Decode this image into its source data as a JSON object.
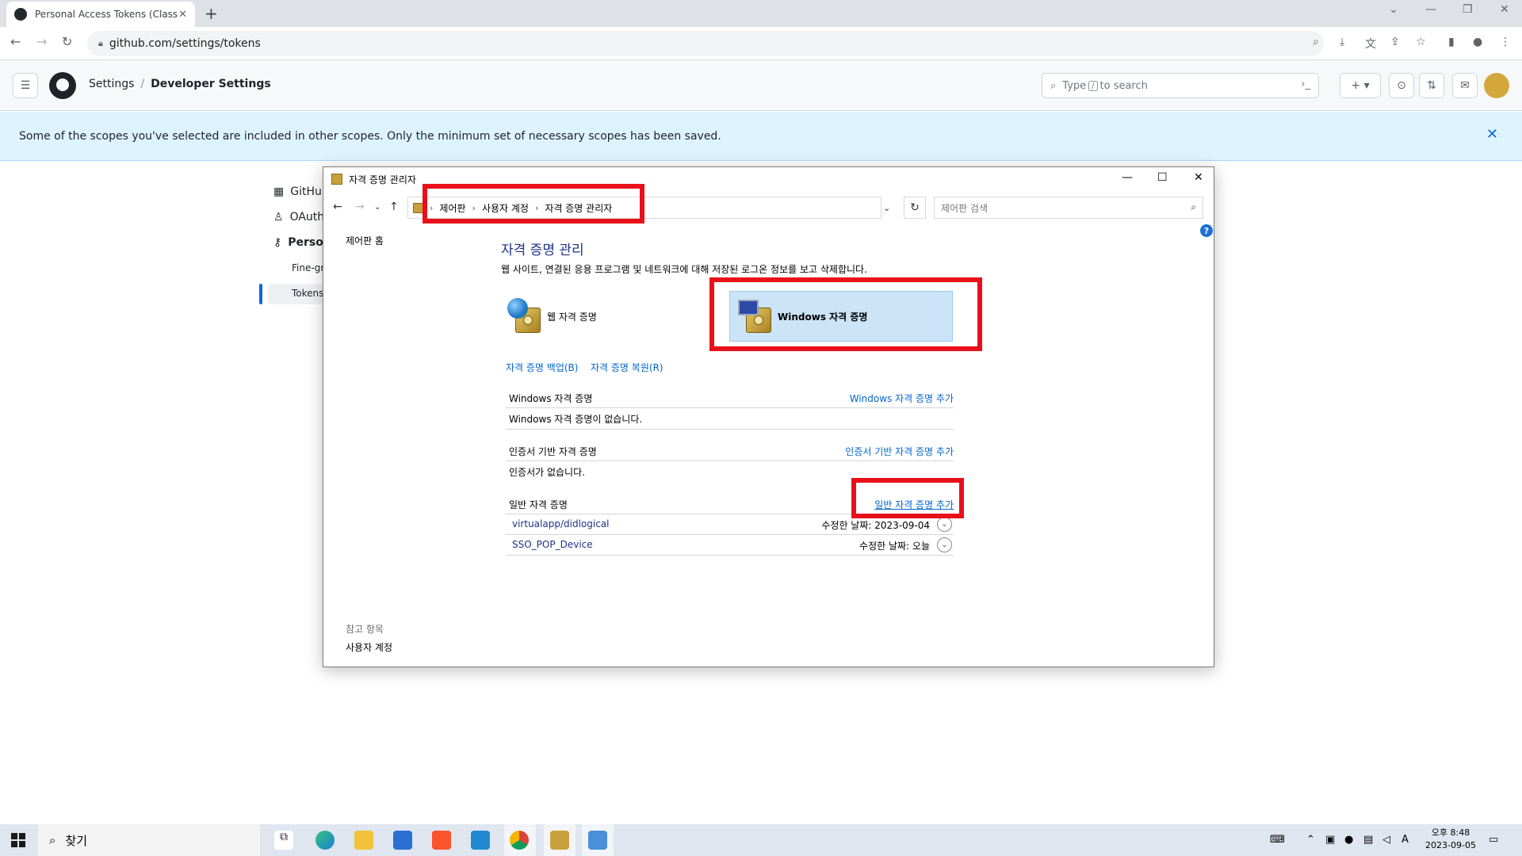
{
  "browser": {
    "tab_title": "Personal Access Tokens (Classic)",
    "tab_close": "✕",
    "new_tab": "+",
    "url": "github.com/settings/tokens"
  },
  "github": {
    "breadcrumb_settings": "Settings",
    "breadcrumb_sep": "/",
    "breadcrumb_developer": "Developer Settings",
    "search_prefix": "Type",
    "search_key": "/",
    "search_suffix": "to search",
    "flash_message": "Some of the scopes you've selected are included in other scopes. Only the minimum set of necessary scopes has been saved.",
    "flash_close": "✕",
    "sidenav": [
      {
        "label": "GitHub"
      },
      {
        "label": "OAuth"
      },
      {
        "label": "Person"
      }
    ],
    "sidenav_sub": [
      {
        "label": "Fine-gr"
      },
      {
        "label": "Tokens"
      }
    ]
  },
  "dialog": {
    "title": "자격 증명 관리자",
    "address": {
      "crumb1": "제어판",
      "crumb2": "사용자 계정",
      "crumb3": "자격 증명 관리자"
    },
    "search_placeholder": "제어판 검색",
    "help": "?",
    "cp_home": "제어판 홈",
    "see_also_title": "참고 항목",
    "see_also_link": "사용자 계정",
    "heading": "자격 증명 관리",
    "description": "웹 사이트, 연결된 응용 프로그램 및 네트워크에 대해 저장된 로그온 정보를 보고 삭제합니다.",
    "tile_web": "웹 자격 증명",
    "tile_windows": "Windows 자격 증명",
    "backup_link": "자격 증명 백업(B)",
    "restore_link": "자격 증명 복원(R)",
    "sections": {
      "windows": {
        "label": "Windows 자격 증명",
        "add": "Windows 자격 증명 추가",
        "empty": "Windows 자격 증명이 없습니다."
      },
      "cert": {
        "label": "인증서 기반 자격 증명",
        "add": "인증서 기반 자격 증명 추가",
        "empty": "인증서가 없습니다."
      },
      "generic": {
        "label": "일반 자격 증명",
        "add": "일반 자격 증명 추가"
      }
    },
    "generic_items": [
      {
        "name": "virtualapp/didlogical",
        "modified": "수정한 날짜: 2023-09-04"
      },
      {
        "name": "SSO_POP_Device",
        "modified": "수정한 날짜: 오늘"
      }
    ]
  },
  "taskbar": {
    "search_label": "찾기",
    "clock_time": "오후 8:48",
    "clock_date": "2023-09-05",
    "ime": "A"
  }
}
